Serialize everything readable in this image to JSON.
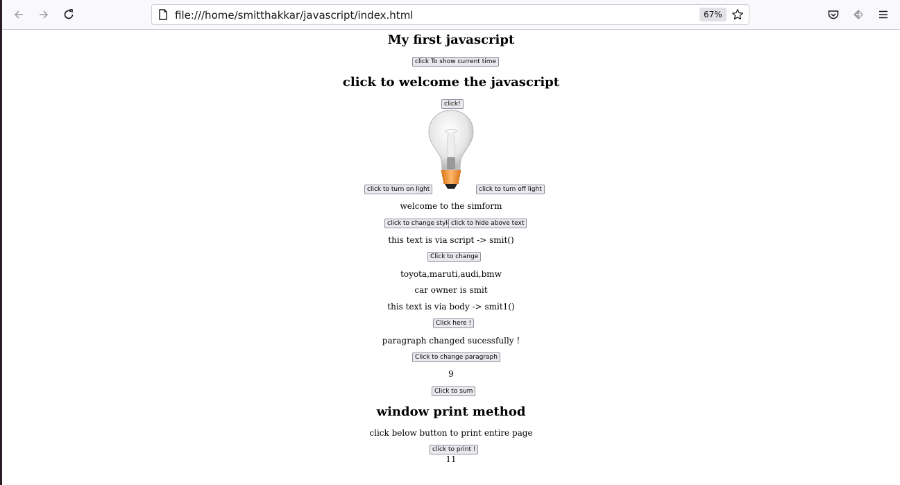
{
  "browser": {
    "url": "file:///home/smitthakkar/javascript/index.html",
    "zoom": "67%"
  },
  "page": {
    "heading_first": "My first javascript",
    "btn_show_time": "click To show current time",
    "heading_welcome": "click to welcome the javascript",
    "btn_click": "click!",
    "btn_turn_on": "click to turn on light",
    "btn_turn_off": "click to turn off light",
    "welcome_text": "welcome to the simform",
    "btn_change_style": "click to change style",
    "btn_hide_text": "click to hide above text",
    "script_text": "this text is via script -> smit()",
    "btn_click_to_change": "Click to change",
    "cars_text": "toyota,maruti,audi,bmw",
    "owner_text": "car owner is smit",
    "body_text": "this text is via body -> smit1()",
    "btn_click_here": "Click here !",
    "paragraph_text": "paragraph changed sucessfully !",
    "btn_change_paragraph": "Click to change paragraph",
    "sum_value": "9",
    "btn_sum": "Click to sum",
    "heading_print": "window print method",
    "print_text": "click below button to print entire page",
    "btn_print": "click to print !",
    "print_value": "11"
  }
}
